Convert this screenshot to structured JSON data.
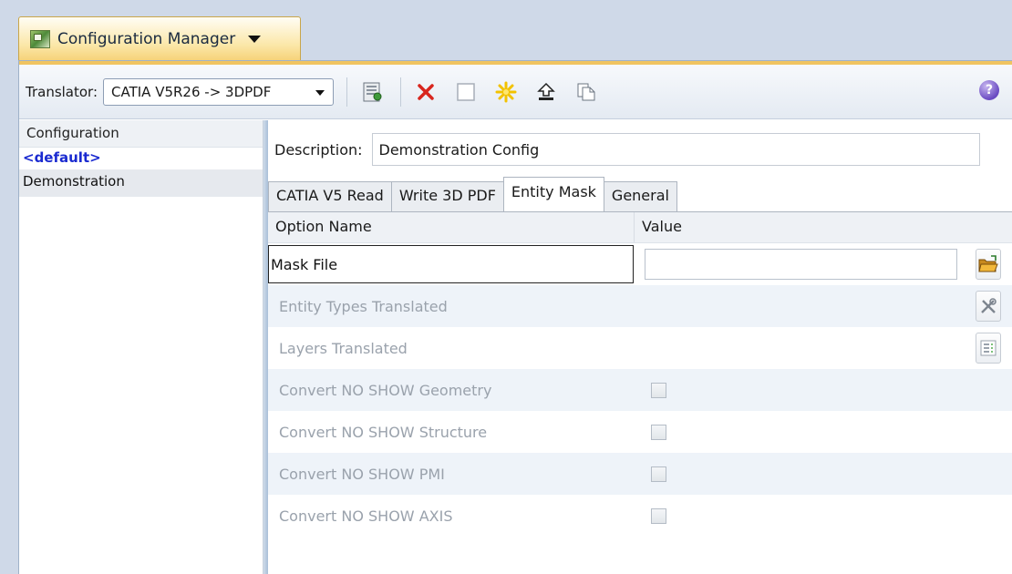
{
  "title_tab": {
    "label": "Configuration Manager"
  },
  "toolbar": {
    "translator_label": "Translator:",
    "translator_value": "CATIA V5R26 -> 3DPDF",
    "help_label": "?"
  },
  "left_panel": {
    "header": "Configuration",
    "items": [
      "<default>",
      "Demonstration"
    ]
  },
  "description": {
    "label": "Description:",
    "value": "Demonstration Config"
  },
  "tabs": [
    "CATIA V5 Read",
    "Write 3D PDF",
    "Entity Mask",
    "General"
  ],
  "active_tab": "Entity Mask",
  "grid": {
    "col_name": "Option Name",
    "col_value": "Value",
    "rows": [
      "Mask File",
      "Entity Types Translated",
      "Layers Translated",
      "Convert NO SHOW Geometry",
      "Convert NO SHOW Structure",
      "Convert NO SHOW PMI",
      "Convert NO SHOW AXIS"
    ]
  },
  "colors": {
    "accent": "#f0c460",
    "default_item": "#1a2ad0",
    "disabled_text": "#9aa2ac",
    "delete_red": "#d8261e"
  }
}
